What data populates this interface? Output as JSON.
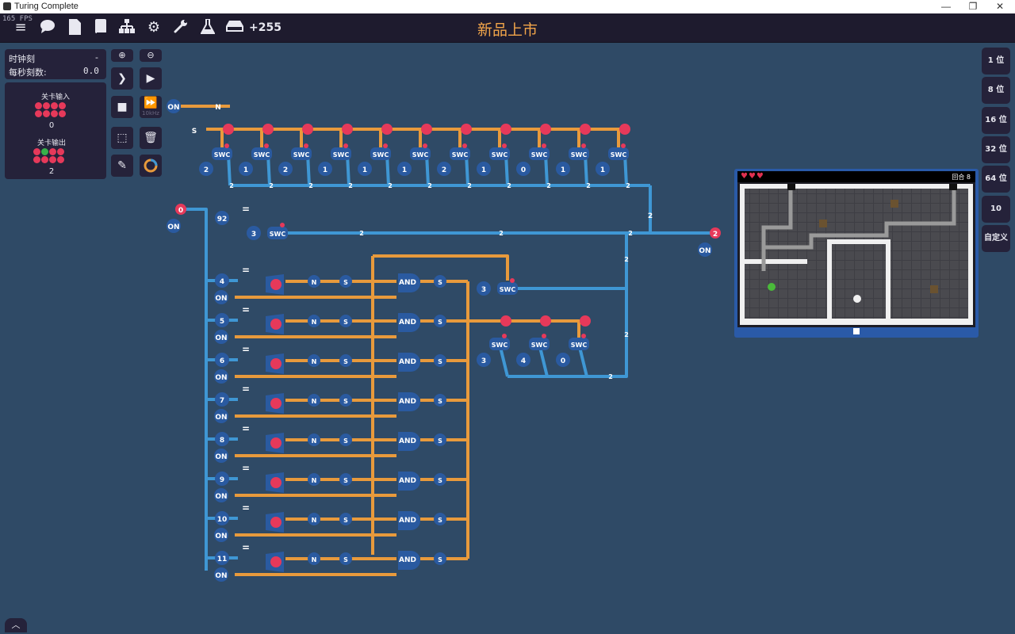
{
  "window": {
    "title": "Turing Complete",
    "minimize": "—",
    "maximize": "❐",
    "close": "✕"
  },
  "fps": "165 FPS",
  "toolbar": {
    "icons": [
      "menu-icon",
      "chat-icon",
      "document-icon",
      "book-icon",
      "hierarchy-icon",
      "gear-icon",
      "wrench-icon",
      "flask-icon",
      "disk-icon"
    ],
    "coins": "+255"
  },
  "level_title": "新品上市",
  "clock": {
    "ticks_label": "时钟刻",
    "ticks_value": "-",
    "tps_label": "每秒刻数:",
    "tps_value": "0.0"
  },
  "level_input": {
    "label": "关卡输入",
    "value": "0"
  },
  "level_output": {
    "label": "关卡输出",
    "value": "2"
  },
  "sim_speed_label": "10kHz",
  "bit_buttons": [
    "1 位",
    "8 位",
    "16 位",
    "32 位",
    "64 位",
    "10",
    "自定义"
  ],
  "circuit": {
    "on_label": "ON",
    "input_value": "0",
    "output_value": "2",
    "top_constants": [
      "2",
      "1",
      "2",
      "1",
      "1",
      "1",
      "2",
      "1",
      "0",
      "1",
      "1"
    ],
    "const_92": "92",
    "const_3": "3",
    "row_constants": [
      "4",
      "5",
      "6",
      "7",
      "8",
      "9",
      "10",
      "11"
    ],
    "and_label": "AND",
    "switch_label": "SWC",
    "not_label": "N",
    "s_label": "S",
    "equal_label": "=",
    "mid_constants": [
      "3",
      "3",
      "4",
      "0"
    ],
    "bus_value": "2"
  },
  "game": {
    "turn_label": "回合",
    "turn_value": "8"
  },
  "colors": {
    "background": "#2f4a66",
    "wire_orange": "#e89a3c",
    "wire_blue": "#3f97d4",
    "accent_title": "#f2a54a",
    "pin_red": "#e6395a"
  }
}
